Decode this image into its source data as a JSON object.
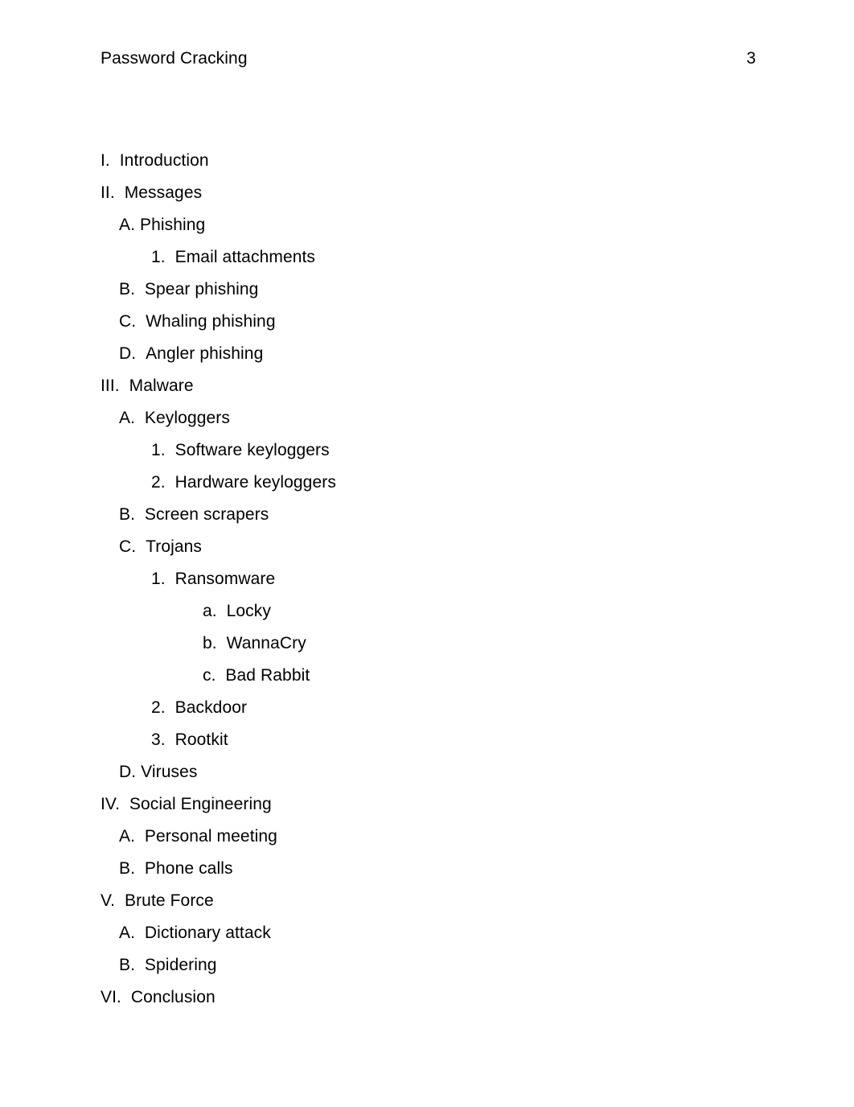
{
  "header": {
    "title": "Password Cracking",
    "page_number": "3"
  },
  "colors": {
    "page_background": "#ffffff",
    "text": "#000000"
  },
  "outline": {
    "items": [
      {
        "level": 1,
        "marker": "I.  ",
        "label": "Introduction"
      },
      {
        "level": 1,
        "marker": "II.  ",
        "label": "Messages"
      },
      {
        "level": 2,
        "marker": "A. ",
        "label": "Phishing"
      },
      {
        "level": 3,
        "marker": "1.  ",
        "label": "Email attachments"
      },
      {
        "level": 2,
        "marker": "B.  ",
        "label": "Spear phishing"
      },
      {
        "level": 2,
        "marker": "C.  ",
        "label": "Whaling phishing"
      },
      {
        "level": 2,
        "marker": "D.  ",
        "label": "Angler phishing"
      },
      {
        "level": 1,
        "marker": "III.  ",
        "label": "Malware"
      },
      {
        "level": 2,
        "marker": "A.  ",
        "label": "Keyloggers"
      },
      {
        "level": 3,
        "marker": "1.  ",
        "label": "Software keyloggers"
      },
      {
        "level": 3,
        "marker": "2.  ",
        "label": "Hardware keyloggers"
      },
      {
        "level": 2,
        "marker": "B.  ",
        "label": "Screen scrapers"
      },
      {
        "level": 2,
        "marker": "C.  ",
        "label": "Trojans"
      },
      {
        "level": 3,
        "marker": "1.  ",
        "label": "Ransomware"
      },
      {
        "level": 4,
        "marker": "a.  ",
        "label": "Locky"
      },
      {
        "level": 4,
        "marker": "b.  ",
        "label": "WannaCry"
      },
      {
        "level": 4,
        "marker": "c.  ",
        "label": "Bad Rabbit"
      },
      {
        "level": 3,
        "marker": "2.  ",
        "label": "Backdoor"
      },
      {
        "level": 3,
        "marker": "3.  ",
        "label": "Rootkit"
      },
      {
        "level": 2,
        "marker": "D. ",
        "label": "Viruses"
      },
      {
        "level": 1,
        "marker": "IV.  ",
        "label": "Social Engineering"
      },
      {
        "level": 2,
        "marker": "A.  ",
        "label": "Personal meeting"
      },
      {
        "level": 2,
        "marker": "B.  ",
        "label": "Phone calls"
      },
      {
        "level": 1,
        "marker": "V.  ",
        "label": "Brute Force"
      },
      {
        "level": 2,
        "marker": "A.  ",
        "label": "Dictionary attack"
      },
      {
        "level": 2,
        "marker": "B.  ",
        "label": "Spidering"
      },
      {
        "level": 1,
        "marker": "VI.  ",
        "label": "Conclusion"
      }
    ]
  }
}
